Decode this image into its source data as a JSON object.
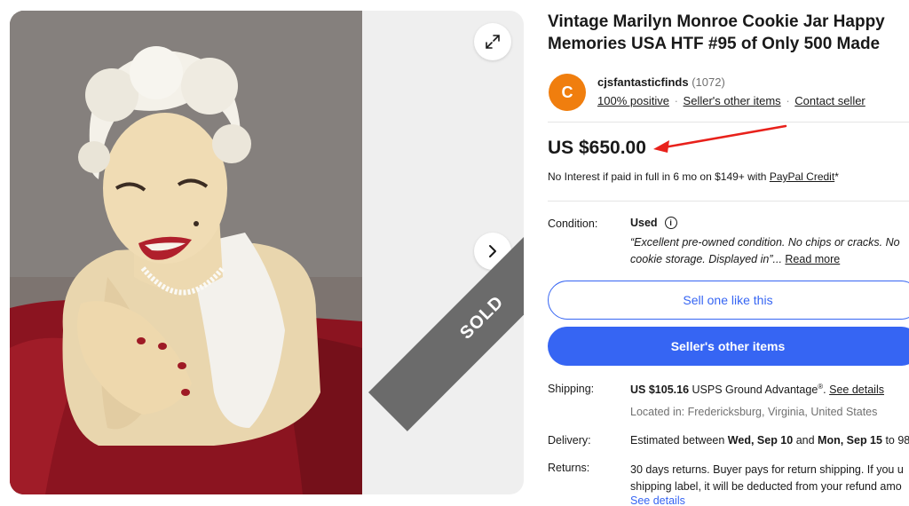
{
  "gallery": {
    "sold_label": "SOLD",
    "expand_icon": "expand-icon",
    "next_icon": "chevron-right-icon"
  },
  "listing": {
    "title": "Vintage Marilyn Monroe Cookie Jar Happy Memories USA HTF #95 of Only 500 Made",
    "price": "US $650.00",
    "paypal_prefix": "No Interest if paid in full in 6 mo on $149+ with ",
    "paypal_link": "PayPal Credit",
    "paypal_suffix": "*"
  },
  "seller": {
    "avatar_letter": "C",
    "name": "cjsfantasticfinds",
    "count": "(1072)",
    "positive": "100% positive",
    "other_items": "Seller's other items",
    "contact": "Contact seller",
    "separator": "·"
  },
  "condition": {
    "label": "Condition:",
    "value": "Used",
    "quote_line1": "“Excellent pre-owned condition. No chips or cracks. No",
    "quote_line2": "cookie storage. Displayed in”...",
    "read_more": "Read more"
  },
  "buttons": {
    "sell_one": "Sell one like this",
    "sellers_other": "Seller's other items"
  },
  "shipping": {
    "label": "Shipping:",
    "price": "US $105.16",
    "method": " USPS Ground Advantage",
    "reg": "®",
    "dot": ". ",
    "details": "See details",
    "location": "Located in: Fredericksburg, Virginia, United States"
  },
  "delivery": {
    "label": "Delivery:",
    "prefix": "Estimated between ",
    "date1": "Wed, Sep 10",
    "mid": " and ",
    "date2": "Mon, Sep 15",
    "suffix": " to 98"
  },
  "returns": {
    "label": "Returns:",
    "line1": "30 days returns. Buyer pays for return shipping. If you u",
    "line2": "shipping label, it will be deducted from your refund amo",
    "details": "See details"
  },
  "colors": {
    "accent": "#3665f3",
    "avatar": "#f07e0e",
    "annotation": "#e8211b"
  }
}
